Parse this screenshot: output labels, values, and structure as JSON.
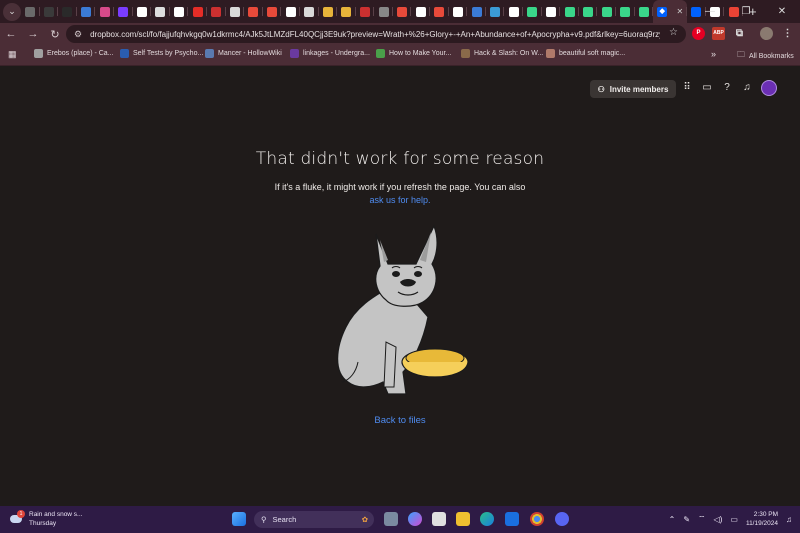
{
  "browser": {
    "tabs": [
      {
        "icon": "chrome-icon",
        "color": "#6a6a6a"
      },
      {
        "icon": "chatgpt-icon",
        "color": "#3a3a3a"
      },
      {
        "icon": "ai-icon",
        "color": "#2a2a2a"
      },
      {
        "icon": "q-icon",
        "color": "#3b7bd6"
      },
      {
        "icon": "app-icon",
        "color": "#d84a8a"
      },
      {
        "icon": "play-icon",
        "color": "#7a3cff"
      },
      {
        "icon": "wiki-icon",
        "color": "#ffffff"
      },
      {
        "icon": "site-icon",
        "color": "#dddddd"
      },
      {
        "icon": "google-icon",
        "color": "#ffffff"
      },
      {
        "icon": "youtube-icon",
        "color": "#e52d27"
      },
      {
        "icon": "site-icon",
        "color": "#cc3030"
      },
      {
        "icon": "site-icon",
        "color": "#d9d9d9"
      },
      {
        "icon": "r-icon",
        "color": "#e84a3a"
      },
      {
        "icon": "r-icon",
        "color": "#e84a3a"
      },
      {
        "icon": "wiki-icon",
        "color": "#ffffff"
      },
      {
        "icon": "site-icon",
        "color": "#d9d9d9"
      },
      {
        "icon": "site-icon",
        "color": "#e8b43a"
      },
      {
        "icon": "site-icon",
        "color": "#e8b43a"
      },
      {
        "icon": "site-icon",
        "color": "#cc3030"
      },
      {
        "icon": "site-icon",
        "color": "#888888"
      },
      {
        "icon": "site-icon",
        "color": "#e84a3a"
      },
      {
        "icon": "x-icon",
        "color": "#ffffff"
      },
      {
        "icon": "site-icon",
        "color": "#e84a3a"
      },
      {
        "icon": "google-icon",
        "color": "#ffffff"
      },
      {
        "icon": "site-icon",
        "color": "#3b7bd6"
      },
      {
        "icon": "site-icon",
        "color": "#3b9bd6"
      },
      {
        "icon": "google-icon",
        "color": "#ffffff"
      },
      {
        "icon": "bolt-icon",
        "color": "#3ad68a"
      },
      {
        "icon": "google-icon",
        "color": "#ffffff"
      },
      {
        "icon": "bolt-icon",
        "color": "#3ad68a"
      },
      {
        "icon": "bolt-icon",
        "color": "#3ad68a"
      },
      {
        "icon": "bolt-icon",
        "color": "#3ad68a"
      },
      {
        "icon": "bolt-icon",
        "color": "#3ad68a"
      },
      {
        "icon": "d-icon",
        "color": "#3ad68a"
      }
    ],
    "active_tab": {
      "icon": "dropbox-icon",
      "color": "#0061fe",
      "close": "✕"
    },
    "after_tabs": [
      {
        "icon": "dropbox-icon",
        "color": "#0061fe"
      },
      {
        "icon": "x-icon",
        "color": "#ffffff"
      },
      {
        "icon": "gmail-icon",
        "color": "#ea4335"
      }
    ],
    "new_tab": "+",
    "url": "dropbox.com/scl/fo/fajjufqhvkgq0w1dkrmc4/AJk5JtLMZdFL40QCjj3E9uk?preview=Wrath+%26+Glory+-+An+Abundance+of+Apocrypha+v9.pdf&rlkey=6uoraq9rzy...",
    "bookmarks": [
      {
        "label": "Erebos (place) - Ca...",
        "color": "#a0a0a0"
      },
      {
        "label": "Self Tests by Psycho...",
        "color": "#2a5db0"
      },
      {
        "label": "Mancer - HollowWiki",
        "color": "#5a7ab0"
      },
      {
        "label": "linkages - Undergra...",
        "color": "#6a3aa0"
      },
      {
        "label": "How to Make Your...",
        "color": "#4aa04a"
      },
      {
        "label": "Hack & Slash: On W...",
        "color": "#8a6a4a"
      },
      {
        "label": "beautiful soft magic...",
        "color": "#b07a6a"
      }
    ],
    "bookmarks_more": "»",
    "all_bookmarks": "All Bookmarks"
  },
  "header": {
    "invite_label": "Invite members"
  },
  "error": {
    "title": "That didn't work for some reason",
    "message_line1": "If it's a fluke, it might work if you refresh the page. You can also",
    "message_link": "ask us for help.",
    "back_link": "Back to files"
  },
  "taskbar": {
    "weather_line1": "Rain and snow s...",
    "weather_line2": "Thursday",
    "weather_badge": "1",
    "search_label": "Search",
    "time": "2:30 PM",
    "date": "11/19/2024"
  },
  "colors": {
    "accent_link": "#4f8cf0",
    "page_bg": "#1f1b1a",
    "browser_frame": "#4b2d36",
    "bowl": "#f5cf5a",
    "dog": "#c4c4c4"
  }
}
